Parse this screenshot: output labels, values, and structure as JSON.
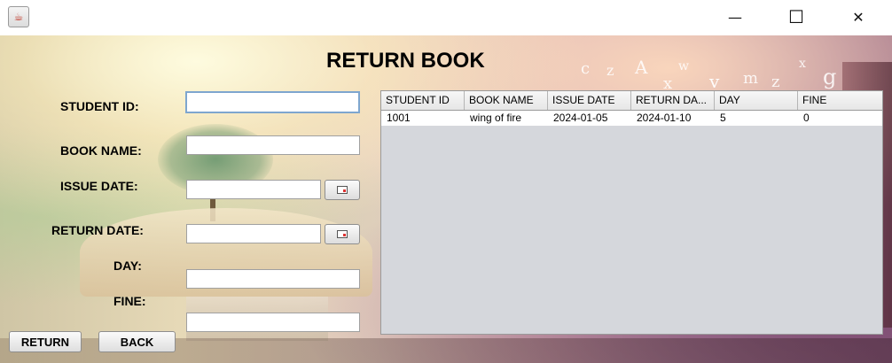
{
  "window": {
    "icon": "java-cup-icon",
    "controls": {
      "minimize": "—",
      "maximize": "☐",
      "close": "✕"
    }
  },
  "page_title": "RETURN BOOK",
  "form": {
    "student_id_label": "STUDENT ID:",
    "book_name_label": "BOOK NAME:",
    "issue_date_label": "ISSUE DATE:",
    "return_date_label": "RETURN DATE:",
    "day_label": "DAY:",
    "fine_label": "FINE:",
    "student_id_value": "",
    "book_name_value": "",
    "issue_date_value": "",
    "return_date_value": "",
    "day_value": "",
    "fine_value": ""
  },
  "buttons": {
    "return": "RETURN",
    "back": "BACK"
  },
  "table": {
    "columns": [
      "STUDENT ID",
      "BOOK NAME",
      "ISSUE DATE",
      "RETURN DA...",
      "DAY",
      "FINE"
    ],
    "rows": [
      [
        "1001",
        "wing of fire",
        "2024-01-05",
        "2024-01-10",
        "5",
        "0"
      ]
    ]
  },
  "background_letters": [
    "c",
    "z",
    "A",
    "w",
    "x",
    "v",
    "m",
    "z",
    "x",
    "g"
  ]
}
